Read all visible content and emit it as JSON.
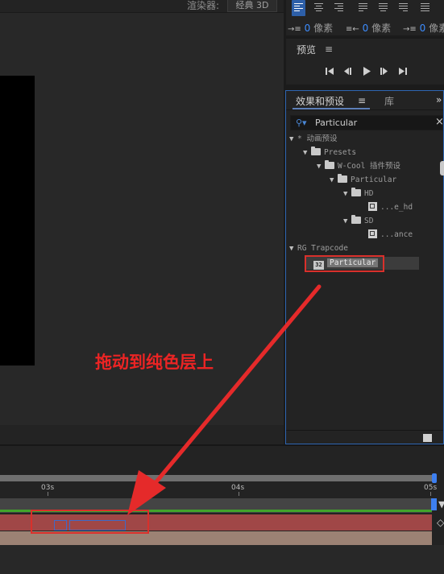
{
  "viewer": {
    "renderer_label": "渲染器:",
    "renderer_value": "经典 3D"
  },
  "paragraph_panel": {
    "indent": [
      {
        "value": "0",
        "unit": "像素"
      },
      {
        "value": "0",
        "unit": "像素"
      },
      {
        "value": "0",
        "unit": "像素"
      }
    ]
  },
  "preview_panel": {
    "title": "预览",
    "menu_icon": "≡"
  },
  "effects_panel": {
    "tab_effects": "效果和预设",
    "tab_menu": "≡",
    "tab_library": "库",
    "close": "»",
    "search_value": "Particular",
    "search_clear": "×",
    "tree": [
      {
        "label": "* 动画预设"
      },
      {
        "label": "Presets"
      },
      {
        "label": "W-Cool 插件预设"
      },
      {
        "label": "Particular"
      },
      {
        "label": "HD"
      },
      {
        "label": "...e_hd"
      },
      {
        "label": "SD"
      },
      {
        "label": "...ance"
      },
      {
        "label": "RG Trapcode"
      },
      {
        "label": "Particular"
      }
    ],
    "effect_icon_text": "32"
  },
  "timeline": {
    "ticks": [
      "03s",
      "04s",
      "05s"
    ]
  },
  "annotation": {
    "text": "拖动到纯色层上",
    "color": "#ec2424"
  },
  "colors": {
    "accent_blue": "#2e66b3",
    "layer_red": "#a04747",
    "highlight_red": "#d9302b",
    "green_bar": "#41a42b"
  }
}
